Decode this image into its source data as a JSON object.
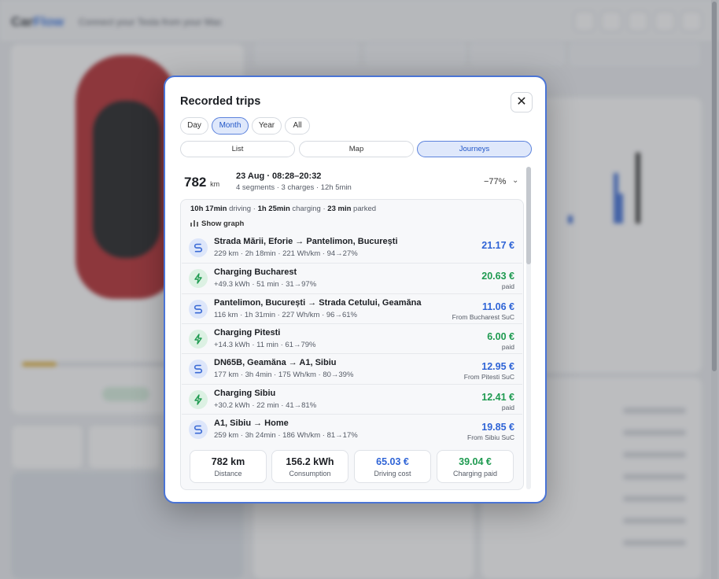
{
  "background": {
    "logo_primary": "Car",
    "logo_accent": "Flow",
    "tagline": "Connect your Tesla from your Mac"
  },
  "modal": {
    "title": "Recorded trips",
    "close_label": "✕",
    "periods": [
      "Day",
      "Month",
      "Year",
      "All"
    ],
    "active_period": "Month",
    "views": [
      "List",
      "Map",
      "Journeys"
    ],
    "active_view": "Journeys",
    "journey": {
      "distance": "782",
      "distance_unit": "km",
      "date": "23 Aug · 08:28–20:32",
      "meta": "4 segments · 3 charges · 12h 5min",
      "battery_delta": "−77%",
      "expand_icon": "chevron-down-icon"
    },
    "summary": {
      "driving_time": "10h 17min",
      "driving_label": "driving",
      "charging_time": "1h 25min",
      "charging_label": "charging",
      "parked_time": "23 min",
      "parked_label": "parked"
    },
    "show_graph_label": "Show graph",
    "segments": [
      {
        "type": "drive",
        "title": "Strada Mării, Eforie → Pantelimon, București",
        "sub": "229 km · 2h 18min · 221 Wh/km · 94→27%",
        "amount": "21.17 €",
        "note": ""
      },
      {
        "type": "charge",
        "title": "Charging Bucharest",
        "sub": "+49.3 kWh · 51 min · 31→97%",
        "amount": "20.63 €",
        "note": "paid"
      },
      {
        "type": "drive",
        "title": "Pantelimon, București → Strada Cetului, Geamăna",
        "sub": "116 km · 1h 31min · 227 Wh/km · 96→61%",
        "amount": "11.06 €",
        "note": "From Bucharest SuC"
      },
      {
        "type": "charge",
        "title": "Charging Pitesti",
        "sub": "+14.3 kWh · 11 min · 61→79%",
        "amount": "6.00 €",
        "note": "paid"
      },
      {
        "type": "drive",
        "title": "DN65B, Geamăna → A1, Sibiu",
        "sub": "177 km · 3h 4min · 175 Wh/km · 80→39%",
        "amount": "12.95 €",
        "note": "From Pitesti SuC"
      },
      {
        "type": "charge",
        "title": "Charging Sibiu",
        "sub": "+30.2 kWh · 22 min · 41→81%",
        "amount": "12.41 €",
        "note": "paid"
      },
      {
        "type": "drive",
        "title": "A1, Sibiu → Home",
        "sub": "259 km · 3h 24min · 186 Wh/km · 81→17%",
        "amount": "19.85 €",
        "note": "From Sibiu SuC"
      }
    ],
    "stats": [
      {
        "value": "782 km",
        "label": "Distance",
        "tone": ""
      },
      {
        "value": "156.2 kWh",
        "label": "Consumption",
        "tone": ""
      },
      {
        "value": "65.03 €",
        "label": "Driving cost",
        "tone": "blue"
      },
      {
        "value": "39.04 €",
        "label": "Charging paid",
        "tone": "green"
      }
    ]
  }
}
